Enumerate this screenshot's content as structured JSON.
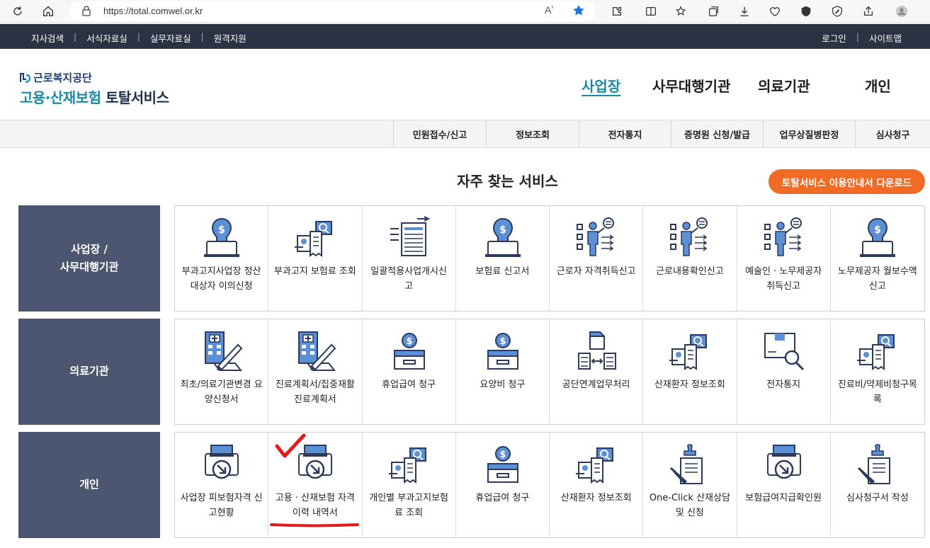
{
  "browser": {
    "url": "https://total.comwel.or.kr",
    "read_aloud": "A̶"
  },
  "util_nav": {
    "left": [
      "지사검색",
      "서식자료실",
      "실무자료실",
      "원격지원"
    ],
    "right": [
      "로그인",
      "사이트맵"
    ],
    "separator": "|"
  },
  "logo": {
    "org": "근로복지공단",
    "title_blue": "고용·산재보험",
    "title_dark": "토탈서비스"
  },
  "main_nav": [
    "사업장",
    "사무대행기관",
    "의료기관",
    "개인"
  ],
  "sub_nav": [
    "민원접수/신고",
    "정보조회",
    "전자통지",
    "증명원 신청/발급",
    "업무상질병판정",
    "심사청구"
  ],
  "section": {
    "title": "자주 찾는 서비스",
    "download_button": "토탈서비스 이용안내서 다운로드"
  },
  "rows": [
    {
      "label": "사업장 /\n사무대행기관",
      "items": [
        {
          "label": "부과고지사업장 정산대상자 이의신청",
          "icon": "money-monitor-icon"
        },
        {
          "label": "부과고지 보험료 조회",
          "icon": "receipt-search-icon"
        },
        {
          "label": "일괄적용사업개시신고",
          "icon": "document-list-icon"
        },
        {
          "label": "보험료 신고서",
          "icon": "money-monitor-icon"
        },
        {
          "label": "근로자 자격취득신고",
          "icon": "worker-list-icon"
        },
        {
          "label": "근로내용확인신고",
          "icon": "worker-list-icon"
        },
        {
          "label": "예술인 · 노무제공자 취득신고",
          "icon": "worker-list-icon"
        },
        {
          "label": "노무제공자 월보수액 신고",
          "icon": "money-monitor-icon"
        }
      ]
    },
    {
      "label": "의료기관",
      "items": [
        {
          "label": "최초/의료기관변경 요양신청서",
          "icon": "hospital-pen-icon"
        },
        {
          "label": "진료계획서/집중재활진료계획서",
          "icon": "hospital-pen-icon"
        },
        {
          "label": "휴업급여 청구",
          "icon": "money-box-icon"
        },
        {
          "label": "요양비 청구",
          "icon": "money-box-icon"
        },
        {
          "label": "공단연계업무처리",
          "icon": "file-exchange-icon"
        },
        {
          "label": "산재환자 정보조회",
          "icon": "receipt-search-icon"
        },
        {
          "label": "전자통지",
          "icon": "box-magnifier-icon"
        },
        {
          "label": "진료비/약제비청구목록",
          "icon": "receipt-search-icon"
        }
      ]
    },
    {
      "label": "개인",
      "items": [
        {
          "label": "사업장 피보험자격 신고현황",
          "icon": "printer-arrow-icon"
        },
        {
          "label": "고용 · 산재보험 자격 이력 내역서",
          "icon": "printer-arrow-icon"
        },
        {
          "label": "개인별 부과고지보험료 조회",
          "icon": "receipt-search-icon"
        },
        {
          "label": "휴업급여 청구",
          "icon": "money-box-icon"
        },
        {
          "label": "산재환자 정보조회",
          "icon": "receipt-search-icon"
        },
        {
          "label": "One-Click 산재상담 및 신청",
          "icon": "stamp-document-icon"
        },
        {
          "label": "보험급여지급확인원",
          "icon": "printer-arrow-icon"
        },
        {
          "label": "심사청구서 작성",
          "icon": "stamp-document-icon"
        }
      ]
    }
  ],
  "colors": {
    "accent": "#1a8aa8",
    "dark_bar": "#2b3242",
    "row_label_bg": "#4c5670",
    "button": "#f26b24",
    "icon_blue": "#5b8fd6",
    "icon_line": "#2d3a5c",
    "annotation_red": "#e21b1b"
  }
}
